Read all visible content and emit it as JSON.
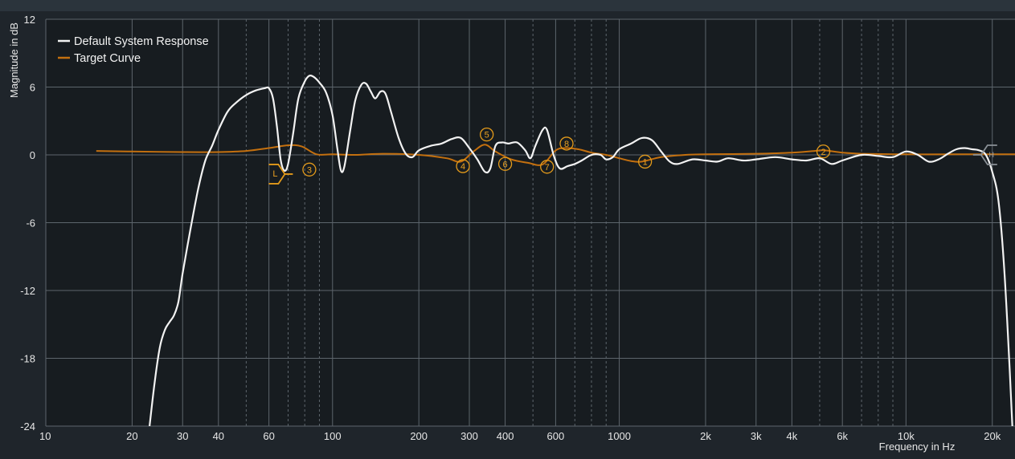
{
  "chart_data": {
    "type": "line",
    "xscale": "log",
    "xlim": [
      10,
      24000
    ],
    "ylim": [
      -24,
      12
    ],
    "xlabel": "Frequency in Hz",
    "ylabel": "Magnitude in dB",
    "x_ticks": [
      {
        "value": 10,
        "label": "10"
      },
      {
        "value": 20,
        "label": "20"
      },
      {
        "value": 30,
        "label": "30"
      },
      {
        "value": 40,
        "label": "40"
      },
      {
        "value": 60,
        "label": "60"
      },
      {
        "value": 100,
        "label": "100"
      },
      {
        "value": 200,
        "label": "200"
      },
      {
        "value": 300,
        "label": "300"
      },
      {
        "value": 400,
        "label": "400"
      },
      {
        "value": 600,
        "label": "600"
      },
      {
        "value": 1000,
        "label": "1000"
      },
      {
        "value": 2000,
        "label": "2k"
      },
      {
        "value": 3000,
        "label": "3k"
      },
      {
        "value": 4000,
        "label": "4k"
      },
      {
        "value": 6000,
        "label": "6k"
      },
      {
        "value": 10000,
        "label": "10k"
      },
      {
        "value": 20000,
        "label": "20k"
      }
    ],
    "y_ticks": [
      {
        "value": 12,
        "label": "12"
      },
      {
        "value": 6,
        "label": "6"
      },
      {
        "value": 0,
        "label": "0"
      },
      {
        "value": -6,
        "label": "-6"
      },
      {
        "value": -12,
        "label": "-12"
      },
      {
        "value": -18,
        "label": "-18"
      },
      {
        "value": -24,
        "label": "-24"
      }
    ],
    "grid": true,
    "legend_position": "top-left",
    "series": [
      {
        "name": "Default System Response",
        "color": "#f2f2f2",
        "points": [
          [
            23,
            -24
          ],
          [
            24,
            -20
          ],
          [
            25,
            -17
          ],
          [
            26,
            -15.5
          ],
          [
            27,
            -14.8
          ],
          [
            28,
            -14.2
          ],
          [
            29,
            -13.0
          ],
          [
            30,
            -10.5
          ],
          [
            32,
            -6.5
          ],
          [
            34,
            -3.0
          ],
          [
            36,
            -0.5
          ],
          [
            38,
            0.8
          ],
          [
            40,
            2.2
          ],
          [
            43,
            3.8
          ],
          [
            46,
            4.6
          ],
          [
            50,
            5.3
          ],
          [
            54,
            5.7
          ],
          [
            58,
            5.9
          ],
          [
            60,
            5.9
          ],
          [
            62,
            5.0
          ],
          [
            64,
            2.5
          ],
          [
            66,
            -0.5
          ],
          [
            68,
            -1.4
          ],
          [
            70,
            -0.8
          ],
          [
            73,
            2.0
          ],
          [
            76,
            5.0
          ],
          [
            80,
            6.5
          ],
          [
            83,
            7.0
          ],
          [
            86,
            6.9
          ],
          [
            90,
            6.4
          ],
          [
            95,
            5.5
          ],
          [
            100,
            3.5
          ],
          [
            104,
            0.5
          ],
          [
            107,
            -1.4
          ],
          [
            110,
            -1.0
          ],
          [
            115,
            2.0
          ],
          [
            120,
            4.8
          ],
          [
            126,
            6.2
          ],
          [
            131,
            6.3
          ],
          [
            136,
            5.6
          ],
          [
            141,
            5.0
          ],
          [
            147,
            5.6
          ],
          [
            153,
            5.4
          ],
          [
            160,
            3.8
          ],
          [
            170,
            1.5
          ],
          [
            180,
            0.1
          ],
          [
            190,
            -0.2
          ],
          [
            200,
            0.4
          ],
          [
            220,
            0.8
          ],
          [
            240,
            1.0
          ],
          [
            260,
            1.4
          ],
          [
            280,
            1.5
          ],
          [
            300,
            0.6
          ],
          [
            320,
            -0.4
          ],
          [
            340,
            -1.5
          ],
          [
            355,
            -1.2
          ],
          [
            370,
            0.8
          ],
          [
            390,
            1.1
          ],
          [
            410,
            1.0
          ],
          [
            440,
            1.1
          ],
          [
            470,
            0.4
          ],
          [
            490,
            -0.3
          ],
          [
            510,
            0.8
          ],
          [
            540,
            2.2
          ],
          [
            560,
            2.2
          ],
          [
            590,
            0.0
          ],
          [
            620,
            -1.2
          ],
          [
            660,
            -1.0
          ],
          [
            700,
            -0.8
          ],
          [
            740,
            -0.5
          ],
          [
            800,
            0.0
          ],
          [
            860,
            0.0
          ],
          [
            900,
            -0.4
          ],
          [
            950,
            -0.2
          ],
          [
            1000,
            0.5
          ],
          [
            1100,
            1.0
          ],
          [
            1200,
            1.5
          ],
          [
            1300,
            1.3
          ],
          [
            1400,
            0.3
          ],
          [
            1500,
            -0.6
          ],
          [
            1600,
            -0.8
          ],
          [
            1800,
            -0.4
          ],
          [
            2000,
            -0.5
          ],
          [
            2200,
            -0.6
          ],
          [
            2400,
            -0.3
          ],
          [
            2700,
            -0.5
          ],
          [
            3000,
            -0.4
          ],
          [
            3500,
            -0.2
          ],
          [
            4000,
            -0.4
          ],
          [
            4500,
            -0.5
          ],
          [
            5000,
            -0.3
          ],
          [
            5500,
            -0.8
          ],
          [
            6000,
            -0.5
          ],
          [
            7000,
            0.0
          ],
          [
            8000,
            -0.1
          ],
          [
            9000,
            -0.2
          ],
          [
            10000,
            0.3
          ],
          [
            11000,
            0.0
          ],
          [
            12000,
            -0.6
          ],
          [
            13000,
            -0.4
          ],
          [
            14000,
            0.1
          ],
          [
            15000,
            0.5
          ],
          [
            16000,
            0.6
          ],
          [
            17000,
            0.5
          ],
          [
            18000,
            0.4
          ],
          [
            19000,
            0.0
          ],
          [
            20000,
            -1.5
          ],
          [
            21000,
            -4.0
          ],
          [
            22000,
            -10.0
          ],
          [
            23000,
            -19.0
          ],
          [
            23500,
            -24
          ]
        ]
      },
      {
        "name": "Target Curve",
        "color": "#c4700f",
        "points": [
          [
            15,
            0.35
          ],
          [
            20,
            0.3
          ],
          [
            30,
            0.25
          ],
          [
            40,
            0.25
          ],
          [
            50,
            0.35
          ],
          [
            60,
            0.6
          ],
          [
            70,
            0.85
          ],
          [
            78,
            0.75
          ],
          [
            88,
            0.05
          ],
          [
            100,
            0.05
          ],
          [
            120,
            0.0
          ],
          [
            150,
            0.1
          ],
          [
            200,
            0.0
          ],
          [
            250,
            -0.3
          ],
          [
            280,
            -0.6
          ],
          [
            310,
            0.3
          ],
          [
            340,
            0.9
          ],
          [
            370,
            0.3
          ],
          [
            420,
            -0.4
          ],
          [
            480,
            -0.7
          ],
          [
            540,
            -0.85
          ],
          [
            600,
            0.4
          ],
          [
            650,
            0.6
          ],
          [
            720,
            0.5
          ],
          [
            800,
            0.2
          ],
          [
            900,
            0.0
          ],
          [
            1000,
            -0.3
          ],
          [
            1100,
            -0.55
          ],
          [
            1200,
            -0.6
          ],
          [
            1400,
            -0.2
          ],
          [
            1700,
            0.0
          ],
          [
            2000,
            0.05
          ],
          [
            3000,
            0.1
          ],
          [
            4000,
            0.2
          ],
          [
            4800,
            0.35
          ],
          [
            5200,
            0.4
          ],
          [
            6000,
            0.2
          ],
          [
            7000,
            0.1
          ],
          [
            10000,
            0.05
          ],
          [
            15000,
            0.05
          ],
          [
            20000,
            0.05
          ],
          [
            24000,
            0.05
          ]
        ]
      }
    ],
    "markers": [
      {
        "label": "1",
        "freq": 1230,
        "db": -0.6
      },
      {
        "label": "2",
        "freq": 5150,
        "db": 0.3
      },
      {
        "label": "3",
        "freq": 83,
        "db": -1.3
      },
      {
        "label": "4",
        "freq": 285,
        "db": -1.0
      },
      {
        "label": "5",
        "freq": 345,
        "db": 1.8
      },
      {
        "label": "6",
        "freq": 400,
        "db": -0.8
      },
      {
        "label": "7",
        "freq": 560,
        "db": -1.05
      },
      {
        "label": "8",
        "freq": 655,
        "db": 1.0
      }
    ],
    "band_limit_low": {
      "freq": 66,
      "db": -1.7,
      "label": "L"
    },
    "band_limit_high": {
      "freq": 19000,
      "db": 0.0,
      "label": "H"
    }
  }
}
